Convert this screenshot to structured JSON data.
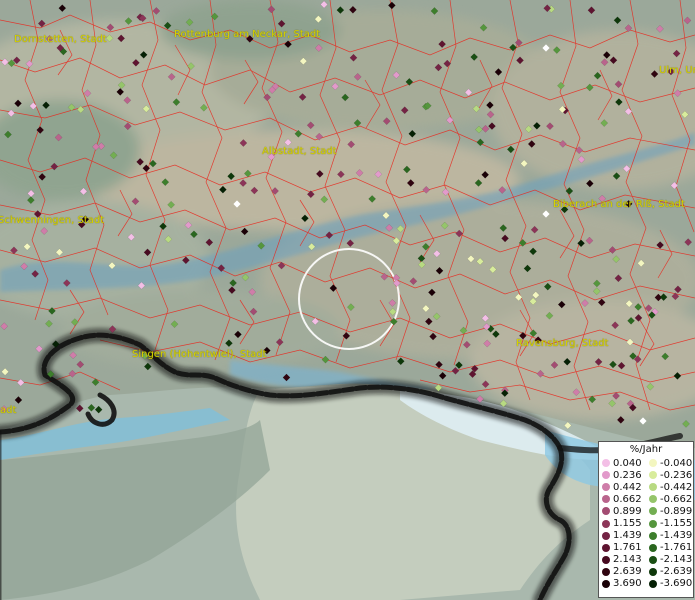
{
  "places": [
    {
      "name": "Dornstetten, Stadt"
    },
    {
      "name": "Rottenburg am Neckar, Stadt"
    },
    {
      "name": "Ulm, Un"
    },
    {
      "name": "Albstadt, Stadt"
    },
    {
      "name": "Biberach an der Riß, Stadt"
    },
    {
      "name": "Schwenningen, Stadt"
    },
    {
      "name": "Singen (Hohentwiel), Stadt"
    },
    {
      "name": "Ravensburg, Stadt"
    },
    {
      "name": "adt"
    }
  ],
  "legend": {
    "title": "%/Jahr",
    "positive": [
      {
        "label": "0.040",
        "color": "#f3bfe6"
      },
      {
        "label": "0.236",
        "color": "#e29acb"
      },
      {
        "label": "0.442",
        "color": "#cf7da9"
      },
      {
        "label": "0.662",
        "color": "#b9648c"
      },
      {
        "label": "0.899",
        "color": "#a34c72"
      },
      {
        "label": "1.155",
        "color": "#8c3558"
      },
      {
        "label": "1.439",
        "color": "#742344"
      },
      {
        "label": "1.761",
        "color": "#5e1430"
      },
      {
        "label": "2.143",
        "color": "#470a20"
      },
      {
        "label": "2.639",
        "color": "#300410"
      },
      {
        "label": "3.690",
        "color": "#1a0006"
      }
    ],
    "negative": [
      {
        "label": "-0.040",
        "color": "#f3f6c0"
      },
      {
        "label": "-0.236",
        "color": "#d8ec9c"
      },
      {
        "label": "-0.442",
        "color": "#b8da82"
      },
      {
        "label": "-0.662",
        "color": "#95c56a"
      },
      {
        "label": "-0.899",
        "color": "#73ae52"
      },
      {
        "label": "-1.155",
        "color": "#55963d"
      },
      {
        "label": "-1.439",
        "color": "#3d7e2c"
      },
      {
        "label": "-1.761",
        "color": "#2a661f"
      },
      {
        "label": "-2.143",
        "color": "#1a4f14"
      },
      {
        "label": "-2.639",
        "color": "#0e380a"
      },
      {
        "label": "-3.690",
        "color": "#052004"
      }
    ]
  }
}
